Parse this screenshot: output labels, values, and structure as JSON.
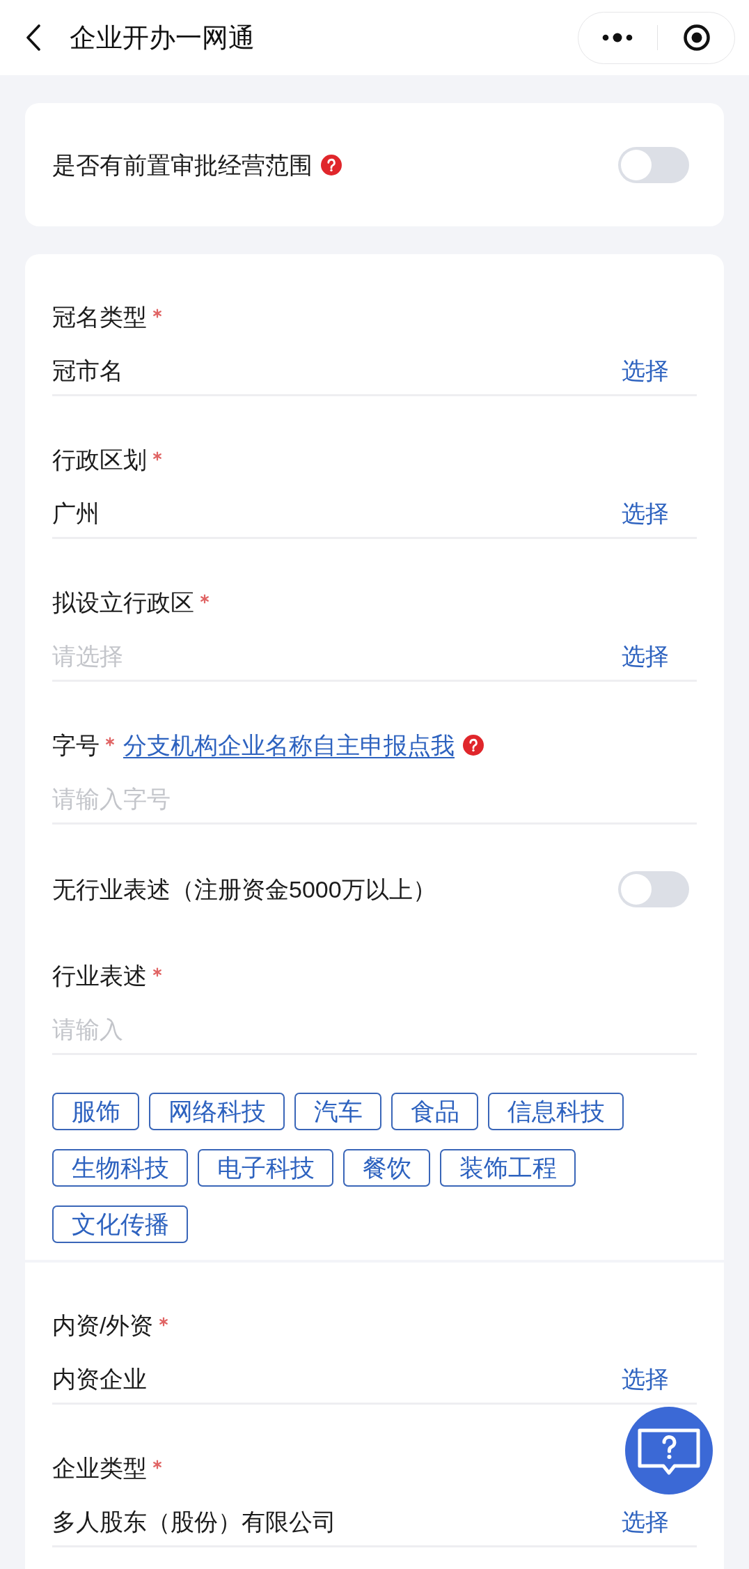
{
  "header": {
    "title": "企业开办一网通"
  },
  "prior_approval": {
    "kind": "toggle",
    "label": "是否有前置审批经营范围",
    "help": true,
    "on": false
  },
  "name_fields": [
    {
      "kind": "select",
      "label": "冠名类型",
      "required": true,
      "value": "冠市名",
      "action": "选择"
    },
    {
      "kind": "select",
      "label": "行政区划",
      "required": true,
      "value": "广州",
      "action": "选择"
    },
    {
      "kind": "select",
      "label": "拟设立行政区",
      "required": true,
      "placeholder": "请选择",
      "action": "选择"
    },
    {
      "kind": "input",
      "label": "字号",
      "required": true,
      "link": "分支机构企业名称自主申报点我",
      "help": true,
      "placeholder": "请输入字号"
    },
    {
      "kind": "toggle",
      "label": "无行业表述（注册资金5000万以上）",
      "on": false
    },
    {
      "kind": "input",
      "label": "行业表述",
      "required": true,
      "placeholder": "请输入"
    }
  ],
  "industry_tags": [
    "服饰",
    "网络科技",
    "汽车",
    "食品",
    "信息科技",
    "生物科技",
    "电子科技",
    "餐饮",
    "装饰工程",
    "文化传播"
  ],
  "company_fields": [
    {
      "kind": "select",
      "label": "内资/外资",
      "required": true,
      "value": "内资企业",
      "action": "选择"
    },
    {
      "kind": "select",
      "label": "企业类型",
      "required": true,
      "value": "多人股东（股份）有限公司",
      "action": "选择"
    }
  ]
}
